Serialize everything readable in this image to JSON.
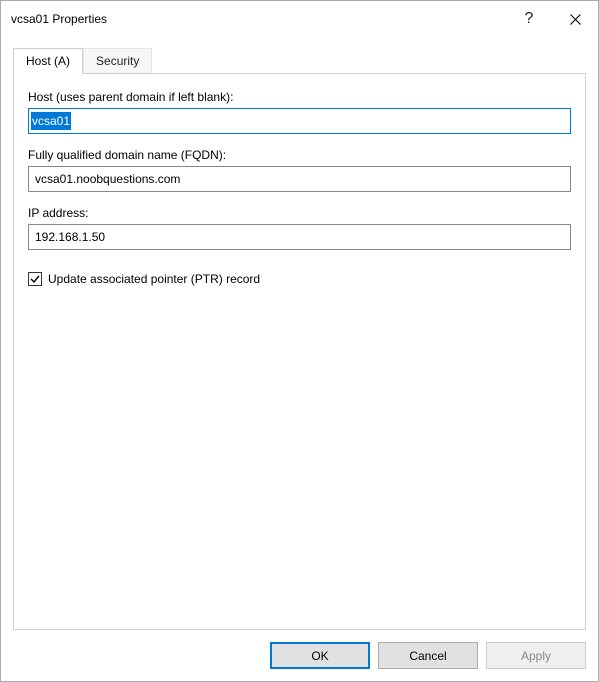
{
  "window": {
    "title": "vcsa01 Properties"
  },
  "tabs": [
    {
      "label": "Host (A)",
      "active": true
    },
    {
      "label": "Security",
      "active": false
    }
  ],
  "fields": {
    "host_label": "Host (uses parent domain if left blank):",
    "host_value": "vcsa01",
    "fqdn_label": "Fully qualified domain name (FQDN):",
    "fqdn_value": "vcsa01.noobquestions.com",
    "ip_label": "IP address:",
    "ip_value": "192.168.1.50",
    "ptr_checked": true,
    "ptr_label": "Update associated pointer (PTR) record"
  },
  "buttons": {
    "ok": "OK",
    "cancel": "Cancel",
    "apply": "Apply"
  }
}
